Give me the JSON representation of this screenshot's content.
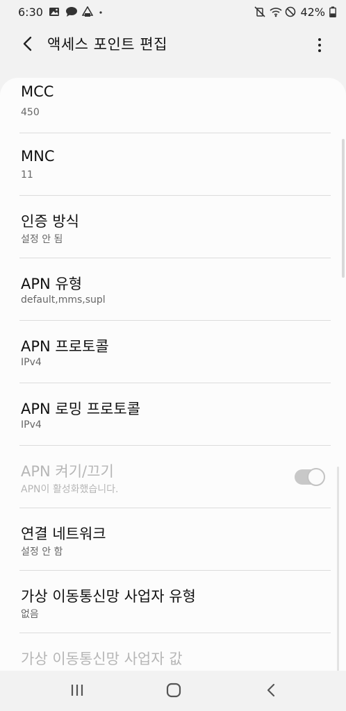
{
  "status_bar": {
    "time": "6:30",
    "battery_percent": "42%",
    "left_icons": [
      "image-icon",
      "chat-bubble-icon",
      "notification-icon"
    ],
    "right_icons": [
      "vibrate-mute-icon",
      "wifi-icon",
      "blocked-icon",
      "battery-icon"
    ],
    "battery_level": 0.42
  },
  "app_bar": {
    "title": "액세스 포인트 편집",
    "back_icon": "back-arrow-icon",
    "more_icon": "more-options-icon"
  },
  "settings": [
    {
      "title": "MCC",
      "value": "450",
      "disabled": false
    },
    {
      "title": "MNC",
      "value": "11",
      "disabled": false
    },
    {
      "title": "인증 방식",
      "value": "설정 안 됨",
      "disabled": false
    },
    {
      "title": "APN 유형",
      "value": "default,mms,supl",
      "disabled": false
    },
    {
      "title": "APN 프로토콜",
      "value": "IPv4",
      "disabled": false
    },
    {
      "title": "APN 로밍 프로토콜",
      "value": "IPv4",
      "disabled": false
    },
    {
      "title": "APN 켜기/끄기",
      "value": "APN이 활성화했습니다.",
      "disabled": true,
      "toggle_on": true
    },
    {
      "title": "연결 네트워크",
      "value": "설정 안 함",
      "disabled": false
    },
    {
      "title": "가상 이동통신망 사업자 유형",
      "value": "없음",
      "disabled": false
    },
    {
      "title": "가상 이동통신망 사업자 값",
      "disabled": true
    }
  ],
  "nav_bar": {
    "icons": [
      "recent-apps-icon",
      "home-icon",
      "back-icon"
    ]
  },
  "colors": {
    "background": "#f2f2f2",
    "card": "#fcfcfc",
    "divider": "#dcdcdc",
    "disabled_text": "#b6b6b6"
  }
}
